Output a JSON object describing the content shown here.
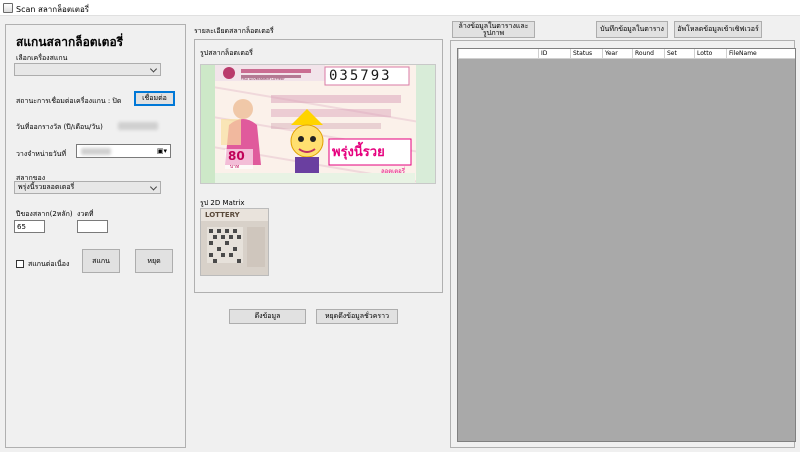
{
  "window": {
    "title": "Scan สลากล็อตเตอรี่"
  },
  "left": {
    "heading": "สแกนสลากล็อตเตอรี่",
    "scanner_label": "เลือกเครื่องสแกน",
    "scanner_value": "",
    "status_label": "สถานะการเชื่อมต่อเครื่องแกน : ปิด",
    "connect_button": "เชื่อมต่อ",
    "award_date_label": "วันที่ออกรางวัล (ปี/เดือน/วัน)",
    "sale_date_label": "วางจำหน่ายวันที่",
    "owner_label": "สลากของ",
    "owner_value": "พรุ่งนี้รวยลอตเตอรี่",
    "year_label": "ปีของสลาก(2หลัก)",
    "round_label": "งวดที่",
    "year_value": "65",
    "round_value": "",
    "continuous_label": "สแกนต่อเนื่อง",
    "continuous_checked": false,
    "scan_button": "สแกน",
    "stop_button": "หยุด"
  },
  "middle": {
    "details_title": "รายละเอียดสลากล็อตเตอรี่",
    "image_label": "รูปสลากล็อตเตอรี่",
    "matrix_label": "รูป 2D Matrix",
    "fetch_button": "ดึงข้อมูล",
    "pause_button": "หยุดดึงข้อมูลชั่วคราว",
    "ticket": {
      "number": "035793",
      "brand": "พรุ่งนี้รวย",
      "sub_brand": "ลอตเตอรี่",
      "price": "80",
      "price_unit": "บาท",
      "header": "THAI GOVERNMENT LOTTERY",
      "matrix_text": "LOTTERY"
    }
  },
  "right": {
    "clear_button": "ล้างข้อมูลในตารางและรูปภาพ",
    "save_button": "บันทึกข้อมูลในตาราง",
    "upload_button": "อัพโหลดข้อมูลเข้าเซิฟเวอร์",
    "columns": [
      "ID",
      "Status",
      "Year",
      "Round",
      "Set",
      "Lotto",
      "FileName"
    ]
  },
  "colors": {
    "focus_blue": "#0078d7",
    "grid_bg": "#a9a9a9",
    "ticket_magenta": "#e6007e",
    "ticket_yellow": "#ffd400"
  }
}
